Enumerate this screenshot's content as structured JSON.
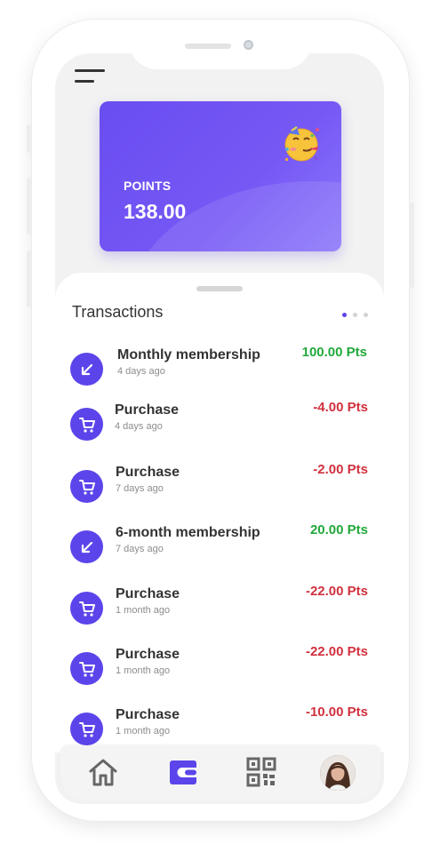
{
  "card": {
    "label": "POINTS",
    "value": "138.00",
    "emoji": "partying-face"
  },
  "transactions": {
    "title": "Transactions",
    "pager": {
      "count": 3,
      "active": 0
    },
    "items": [
      {
        "name": "Monthly membership",
        "time": "4 days ago",
        "amount": "100.00 Pts",
        "type": "credit"
      },
      {
        "name": "Purchase",
        "time": "4 days ago",
        "amount": "-4.00 Pts",
        "type": "purchase"
      },
      {
        "name": "Purchase",
        "time": "7 days ago",
        "amount": "-2.00 Pts",
        "type": "purchase"
      },
      {
        "name": "6-month membership",
        "time": "7 days ago",
        "amount": "20.00 Pts",
        "type": "credit"
      },
      {
        "name": "Purchase",
        "time": "1 month ago",
        "amount": "-22.00 Pts",
        "type": "purchase"
      },
      {
        "name": "Purchase",
        "time": "1 month ago",
        "amount": "-22.00 Pts",
        "type": "purchase"
      },
      {
        "name": "Purchase",
        "time": "1 month ago",
        "amount": "-10.00 Pts",
        "type": "purchase"
      }
    ]
  },
  "nav": {
    "items": [
      "home-icon",
      "wallet-icon",
      "qr-code-icon",
      "profile-avatar"
    ],
    "active": "wallet-icon"
  },
  "colors": {
    "accent": "#5b45ea",
    "positive": "#22a83a",
    "negative": "#d1303e"
  }
}
